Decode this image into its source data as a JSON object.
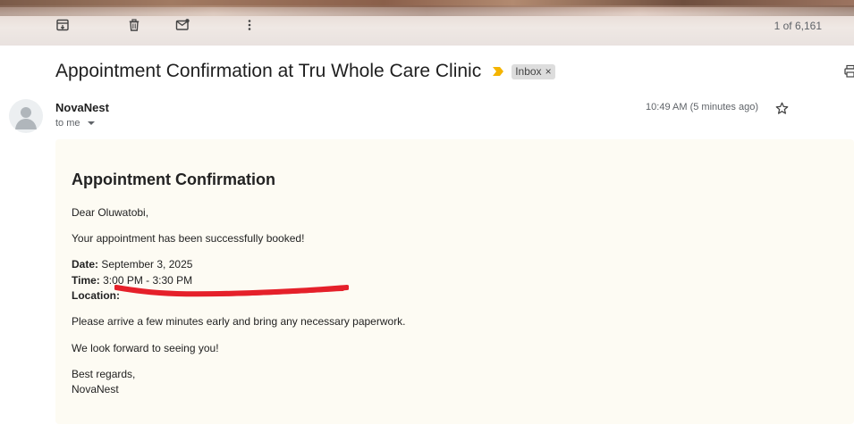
{
  "toolbar": {
    "archive_icon": "archive-icon",
    "delete_icon": "trash-icon",
    "mark_unread_icon": "mark-unread-icon",
    "more_icon": "more-vert-icon",
    "page_count": "1 of 6,161"
  },
  "email": {
    "subject": "Appointment Confirmation at Tru Whole Care Clinic",
    "label": "Inbox",
    "label_close": "×",
    "sender": "NovaNest",
    "recipient": "to me",
    "timestamp": "10:49 AM (5 minutes ago)"
  },
  "body": {
    "heading": "Appointment Confirmation",
    "greeting": "Dear Oluwatobi,",
    "intro": "Your appointment has been successfully booked!",
    "date_label": "Date:",
    "date_value": " September 3, 2025",
    "time_label": "Time:",
    "time_value": " 3:00 PM - 3:30 PM",
    "location_label": "Location:",
    "location_value": "",
    "instructions": "Please arrive a few minutes early and bring any necessary paperwork.",
    "closing_line": "We look forward to seeing you!",
    "sign_off": "Best regards,",
    "signature": "NovaNest"
  },
  "colors": {
    "accent_importance": "#f4b400",
    "redaction": "#e5202a",
    "card_bg": "#fdfbf3"
  }
}
